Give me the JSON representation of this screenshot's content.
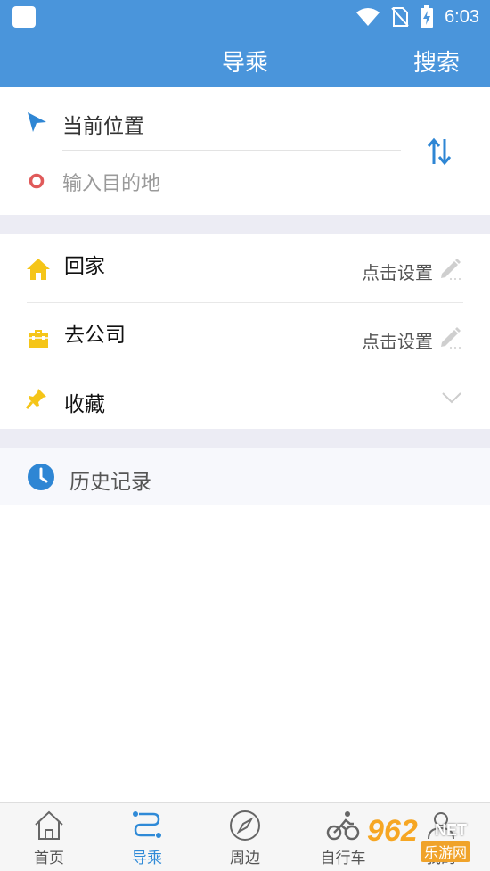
{
  "status_bar": {
    "time": "6:03"
  },
  "header": {
    "title": "导乘",
    "search_label": "搜索"
  },
  "route": {
    "current_location": "当前位置",
    "destination_placeholder": "输入目的地"
  },
  "shortcuts": [
    {
      "label": "回家",
      "action": "点击设置"
    },
    {
      "label": "去公司",
      "action": "点击设置"
    },
    {
      "label": "收藏"
    }
  ],
  "history": {
    "label": "历史记录"
  },
  "tabs": [
    {
      "label": "首页",
      "active": false
    },
    {
      "label": "导乘",
      "active": true
    },
    {
      "label": "周边",
      "active": false
    },
    {
      "label": "自行车",
      "active": false
    },
    {
      "label": "我的",
      "active": false
    }
  ],
  "colors": {
    "accent": "#4a95db",
    "tab_active": "#2f8ad7",
    "home_icon": "#f5c518",
    "destination_icon": "#e05a5a"
  },
  "watermark": {
    "brand": "962",
    "suffix": "NET",
    "sub": "乐游网"
  }
}
